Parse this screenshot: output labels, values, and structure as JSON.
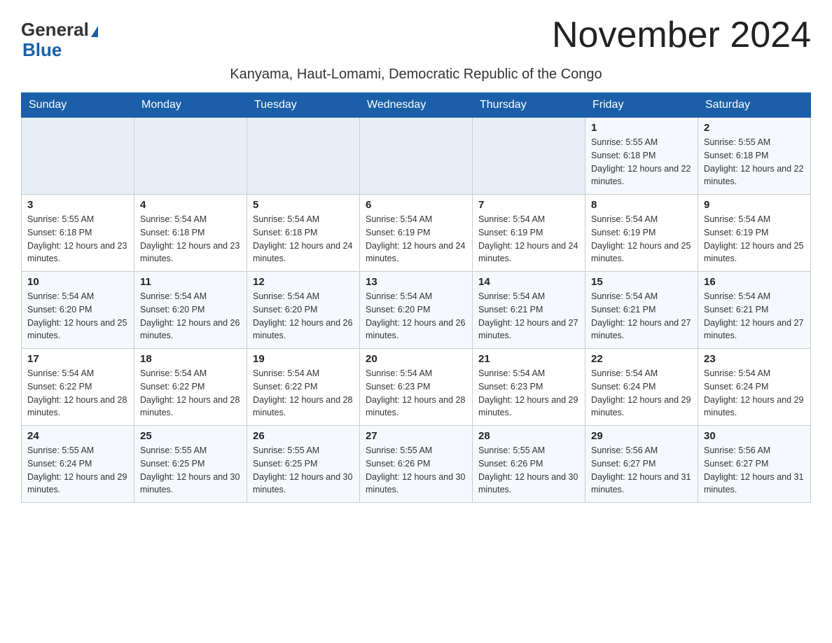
{
  "header": {
    "logo_general": "General",
    "logo_blue": "Blue",
    "month_title": "November 2024",
    "location": "Kanyama, Haut-Lomami, Democratic Republic of the Congo"
  },
  "calendar": {
    "weekdays": [
      "Sunday",
      "Monday",
      "Tuesday",
      "Wednesday",
      "Thursday",
      "Friday",
      "Saturday"
    ],
    "weeks": [
      [
        {
          "day": "",
          "sunrise": "",
          "sunset": "",
          "daylight": ""
        },
        {
          "day": "",
          "sunrise": "",
          "sunset": "",
          "daylight": ""
        },
        {
          "day": "",
          "sunrise": "",
          "sunset": "",
          "daylight": ""
        },
        {
          "day": "",
          "sunrise": "",
          "sunset": "",
          "daylight": ""
        },
        {
          "day": "",
          "sunrise": "",
          "sunset": "",
          "daylight": ""
        },
        {
          "day": "1",
          "sunrise": "Sunrise: 5:55 AM",
          "sunset": "Sunset: 6:18 PM",
          "daylight": "Daylight: 12 hours and 22 minutes."
        },
        {
          "day": "2",
          "sunrise": "Sunrise: 5:55 AM",
          "sunset": "Sunset: 6:18 PM",
          "daylight": "Daylight: 12 hours and 22 minutes."
        }
      ],
      [
        {
          "day": "3",
          "sunrise": "Sunrise: 5:55 AM",
          "sunset": "Sunset: 6:18 PM",
          "daylight": "Daylight: 12 hours and 23 minutes."
        },
        {
          "day": "4",
          "sunrise": "Sunrise: 5:54 AM",
          "sunset": "Sunset: 6:18 PM",
          "daylight": "Daylight: 12 hours and 23 minutes."
        },
        {
          "day": "5",
          "sunrise": "Sunrise: 5:54 AM",
          "sunset": "Sunset: 6:18 PM",
          "daylight": "Daylight: 12 hours and 24 minutes."
        },
        {
          "day": "6",
          "sunrise": "Sunrise: 5:54 AM",
          "sunset": "Sunset: 6:19 PM",
          "daylight": "Daylight: 12 hours and 24 minutes."
        },
        {
          "day": "7",
          "sunrise": "Sunrise: 5:54 AM",
          "sunset": "Sunset: 6:19 PM",
          "daylight": "Daylight: 12 hours and 24 minutes."
        },
        {
          "day": "8",
          "sunrise": "Sunrise: 5:54 AM",
          "sunset": "Sunset: 6:19 PM",
          "daylight": "Daylight: 12 hours and 25 minutes."
        },
        {
          "day": "9",
          "sunrise": "Sunrise: 5:54 AM",
          "sunset": "Sunset: 6:19 PM",
          "daylight": "Daylight: 12 hours and 25 minutes."
        }
      ],
      [
        {
          "day": "10",
          "sunrise": "Sunrise: 5:54 AM",
          "sunset": "Sunset: 6:20 PM",
          "daylight": "Daylight: 12 hours and 25 minutes."
        },
        {
          "day": "11",
          "sunrise": "Sunrise: 5:54 AM",
          "sunset": "Sunset: 6:20 PM",
          "daylight": "Daylight: 12 hours and 26 minutes."
        },
        {
          "day": "12",
          "sunrise": "Sunrise: 5:54 AM",
          "sunset": "Sunset: 6:20 PM",
          "daylight": "Daylight: 12 hours and 26 minutes."
        },
        {
          "day": "13",
          "sunrise": "Sunrise: 5:54 AM",
          "sunset": "Sunset: 6:20 PM",
          "daylight": "Daylight: 12 hours and 26 minutes."
        },
        {
          "day": "14",
          "sunrise": "Sunrise: 5:54 AM",
          "sunset": "Sunset: 6:21 PM",
          "daylight": "Daylight: 12 hours and 27 minutes."
        },
        {
          "day": "15",
          "sunrise": "Sunrise: 5:54 AM",
          "sunset": "Sunset: 6:21 PM",
          "daylight": "Daylight: 12 hours and 27 minutes."
        },
        {
          "day": "16",
          "sunrise": "Sunrise: 5:54 AM",
          "sunset": "Sunset: 6:21 PM",
          "daylight": "Daylight: 12 hours and 27 minutes."
        }
      ],
      [
        {
          "day": "17",
          "sunrise": "Sunrise: 5:54 AM",
          "sunset": "Sunset: 6:22 PM",
          "daylight": "Daylight: 12 hours and 28 minutes."
        },
        {
          "day": "18",
          "sunrise": "Sunrise: 5:54 AM",
          "sunset": "Sunset: 6:22 PM",
          "daylight": "Daylight: 12 hours and 28 minutes."
        },
        {
          "day": "19",
          "sunrise": "Sunrise: 5:54 AM",
          "sunset": "Sunset: 6:22 PM",
          "daylight": "Daylight: 12 hours and 28 minutes."
        },
        {
          "day": "20",
          "sunrise": "Sunrise: 5:54 AM",
          "sunset": "Sunset: 6:23 PM",
          "daylight": "Daylight: 12 hours and 28 minutes."
        },
        {
          "day": "21",
          "sunrise": "Sunrise: 5:54 AM",
          "sunset": "Sunset: 6:23 PM",
          "daylight": "Daylight: 12 hours and 29 minutes."
        },
        {
          "day": "22",
          "sunrise": "Sunrise: 5:54 AM",
          "sunset": "Sunset: 6:24 PM",
          "daylight": "Daylight: 12 hours and 29 minutes."
        },
        {
          "day": "23",
          "sunrise": "Sunrise: 5:54 AM",
          "sunset": "Sunset: 6:24 PM",
          "daylight": "Daylight: 12 hours and 29 minutes."
        }
      ],
      [
        {
          "day": "24",
          "sunrise": "Sunrise: 5:55 AM",
          "sunset": "Sunset: 6:24 PM",
          "daylight": "Daylight: 12 hours and 29 minutes."
        },
        {
          "day": "25",
          "sunrise": "Sunrise: 5:55 AM",
          "sunset": "Sunset: 6:25 PM",
          "daylight": "Daylight: 12 hours and 30 minutes."
        },
        {
          "day": "26",
          "sunrise": "Sunrise: 5:55 AM",
          "sunset": "Sunset: 6:25 PM",
          "daylight": "Daylight: 12 hours and 30 minutes."
        },
        {
          "day": "27",
          "sunrise": "Sunrise: 5:55 AM",
          "sunset": "Sunset: 6:26 PM",
          "daylight": "Daylight: 12 hours and 30 minutes."
        },
        {
          "day": "28",
          "sunrise": "Sunrise: 5:55 AM",
          "sunset": "Sunset: 6:26 PM",
          "daylight": "Daylight: 12 hours and 30 minutes."
        },
        {
          "day": "29",
          "sunrise": "Sunrise: 5:56 AM",
          "sunset": "Sunset: 6:27 PM",
          "daylight": "Daylight: 12 hours and 31 minutes."
        },
        {
          "day": "30",
          "sunrise": "Sunrise: 5:56 AM",
          "sunset": "Sunset: 6:27 PM",
          "daylight": "Daylight: 12 hours and 31 minutes."
        }
      ]
    ]
  }
}
